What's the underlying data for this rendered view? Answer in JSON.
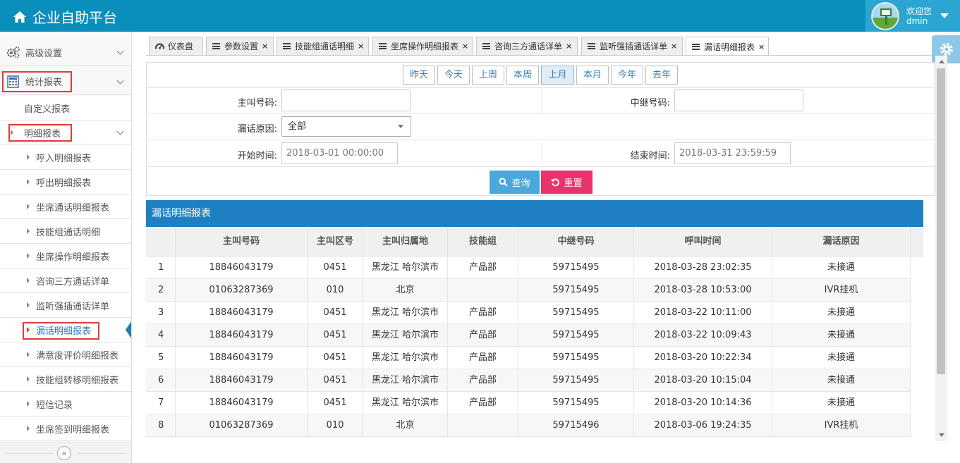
{
  "app": {
    "title": "企业自助平台"
  },
  "user": {
    "greeting": "欢迎您",
    "name": "dmin"
  },
  "sidebar": {
    "advanced": "高级设置",
    "stats": "统计报表",
    "custom_report": "自定义报表",
    "detail_reports": "明细报表",
    "items": [
      "呼入明细报表",
      "呼出明细报表",
      "坐席通话明细报表",
      "技能组通话明细",
      "坐席操作明细报表",
      "咨询三方通话详单",
      "监听强插通话详单",
      "漏话明细报表",
      "满意度评价明细报表",
      "技能组转移明细报表",
      "短信记录",
      "坐席签到明细报表"
    ],
    "collapse_symbol": "«"
  },
  "tabs": [
    {
      "label": "仪表盘",
      "closable": false
    },
    {
      "label": "参数设置",
      "closable": true
    },
    {
      "label": "技能组通话明细",
      "closable": true
    },
    {
      "label": "坐席操作明细报表",
      "closable": true
    },
    {
      "label": "咨询三方通话详单",
      "closable": true
    },
    {
      "label": "监听强插通话详单",
      "closable": true
    },
    {
      "label": "漏话明细报表",
      "closable": true
    }
  ],
  "tab_close": "×",
  "filters": {
    "date_buttons": [
      "昨天",
      "今天",
      "上周",
      "本周",
      "上月",
      "本月",
      "今年",
      "去年"
    ],
    "selected_date": "上月",
    "caller_label": "主叫号码:",
    "caller_value": "",
    "trunk_label": "中继号码:",
    "trunk_value": "",
    "reason_label": "漏话原因:",
    "reason_value": "全部",
    "start_label": "开始时间:",
    "start_value": "2018-03-01 00:00:00",
    "end_label": "结束时间:",
    "end_value": "2018-03-31 23:59:59",
    "query_label": "查询",
    "reset_label": "重置"
  },
  "report": {
    "title": "漏话明细报表",
    "columns": [
      "",
      "主叫号码",
      "主叫区号",
      "主叫归属地",
      "技能组",
      "中继号码",
      "呼叫时间",
      "漏话原因"
    ],
    "rows": [
      [
        "1",
        "18846043179",
        "0451",
        "黑龙江 哈尔滨市",
        "产品部",
        "59715495",
        "2018-03-28 23:02:35",
        "未接通"
      ],
      [
        "2",
        "01063287369",
        "010",
        "北京",
        "",
        "59715495",
        "2018-03-28 10:53:00",
        "IVR挂机"
      ],
      [
        "3",
        "18846043179",
        "0451",
        "黑龙江 哈尔滨市",
        "产品部",
        "59715495",
        "2018-03-22 10:11:00",
        "未接通"
      ],
      [
        "4",
        "18846043179",
        "0451",
        "黑龙江 哈尔滨市",
        "产品部",
        "59715495",
        "2018-03-22 10:09:43",
        "未接通"
      ],
      [
        "5",
        "18846043179",
        "0451",
        "黑龙江 哈尔滨市",
        "产品部",
        "59715495",
        "2018-03-20 10:22:34",
        "未接通"
      ],
      [
        "6",
        "18846043179",
        "0451",
        "黑龙江 哈尔滨市",
        "产品部",
        "59715495",
        "2018-03-20 10:15:04",
        "未接通"
      ],
      [
        "7",
        "18846043179",
        "0451",
        "黑龙江 哈尔滨市",
        "产品部",
        "59715495",
        "2018-03-20 10:14:36",
        "未接通"
      ],
      [
        "8",
        "01063287369",
        "010",
        "北京",
        "",
        "59715496",
        "2018-03-06 19:24:35",
        "IVR挂机"
      ]
    ]
  },
  "colors": {
    "navbar": "#0a8fbd",
    "report_header": "#1f80c1",
    "query_button": "#4aa8dc",
    "reset_button": "#e8336c",
    "highlight_box": "#e23a3a"
  }
}
